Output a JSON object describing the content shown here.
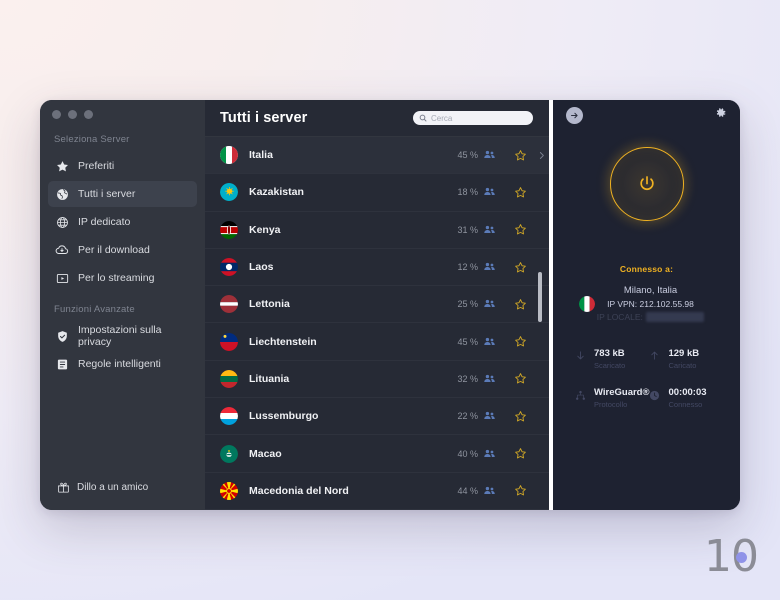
{
  "window": {
    "traffic_lights": [
      "close",
      "minimize",
      "maximize"
    ]
  },
  "sidebar": {
    "section_servers": "Seleziona Server",
    "items": [
      {
        "label": "Preferiti",
        "icon": "star-icon",
        "active": false
      },
      {
        "label": "Tutti i server",
        "icon": "globe-filled-icon",
        "active": true
      },
      {
        "label": "IP dedicato",
        "icon": "globe-grid-icon",
        "active": false
      },
      {
        "label": "Per il download",
        "icon": "cloud-download-icon",
        "active": false
      },
      {
        "label": "Per lo streaming",
        "icon": "streaming-icon",
        "active": false
      }
    ],
    "section_advanced": "Funzioni Avanzate",
    "advanced_items": [
      {
        "label": "Impostazioni sulla privacy",
        "icon": "shield-check-icon"
      },
      {
        "label": "Regole intelligenti",
        "icon": "rules-icon"
      }
    ],
    "footer": {
      "label": "Dillo a un amico",
      "icon": "gift-icon"
    }
  },
  "list": {
    "title": "Tutti i server",
    "search_placeholder": "Cerca",
    "search_value": "",
    "servers": [
      {
        "name": "Italia",
        "load": "45 %",
        "flag": "it",
        "hover": true
      },
      {
        "name": "Kazakistan",
        "load": "18 %",
        "flag": "kz",
        "hover": false
      },
      {
        "name": "Kenya",
        "load": "31 %",
        "flag": "ke",
        "hover": false
      },
      {
        "name": "Laos",
        "load": "12 %",
        "flag": "la",
        "hover": false
      },
      {
        "name": "Lettonia",
        "load": "25 %",
        "flag": "lv",
        "hover": false
      },
      {
        "name": "Liechtenstein",
        "load": "45 %",
        "flag": "li",
        "hover": false
      },
      {
        "name": "Lituania",
        "load": "32 %",
        "flag": "lt",
        "hover": false
      },
      {
        "name": "Lussemburgo",
        "load": "22 %",
        "flag": "lu",
        "hover": false
      },
      {
        "name": "Macao",
        "load": "40 %",
        "flag": "mo",
        "hover": false
      },
      {
        "name": "Macedonia del Nord",
        "load": "44 %",
        "flag": "mk",
        "hover": false
      }
    ]
  },
  "connection": {
    "power_state": "on",
    "connected_label": "Connesso a:",
    "city": "Milano, Italia",
    "vpn_ip": "IP VPN: 212.102.55.98",
    "local_ip_label": "IP LOCALE:",
    "local_ip_value": "192.168.1.100",
    "stats": [
      {
        "icon": "arrow-down-icon",
        "value": "783 kB",
        "label": "Scaricato"
      },
      {
        "icon": "arrow-up-icon",
        "value": "129 kB",
        "label": "Caricato"
      },
      {
        "icon": "protocol-icon",
        "value": "WireGuard®",
        "label": "Protocollo"
      },
      {
        "icon": "clock-icon",
        "value": "00:00:03",
        "label": "Connesso"
      }
    ]
  },
  "watermark": {
    "text": "10"
  },
  "colors": {
    "accent": "#f0b222",
    "sidebar": "#32363f",
    "list_bg": "#262a35",
    "right_bg": "#1e2231"
  }
}
